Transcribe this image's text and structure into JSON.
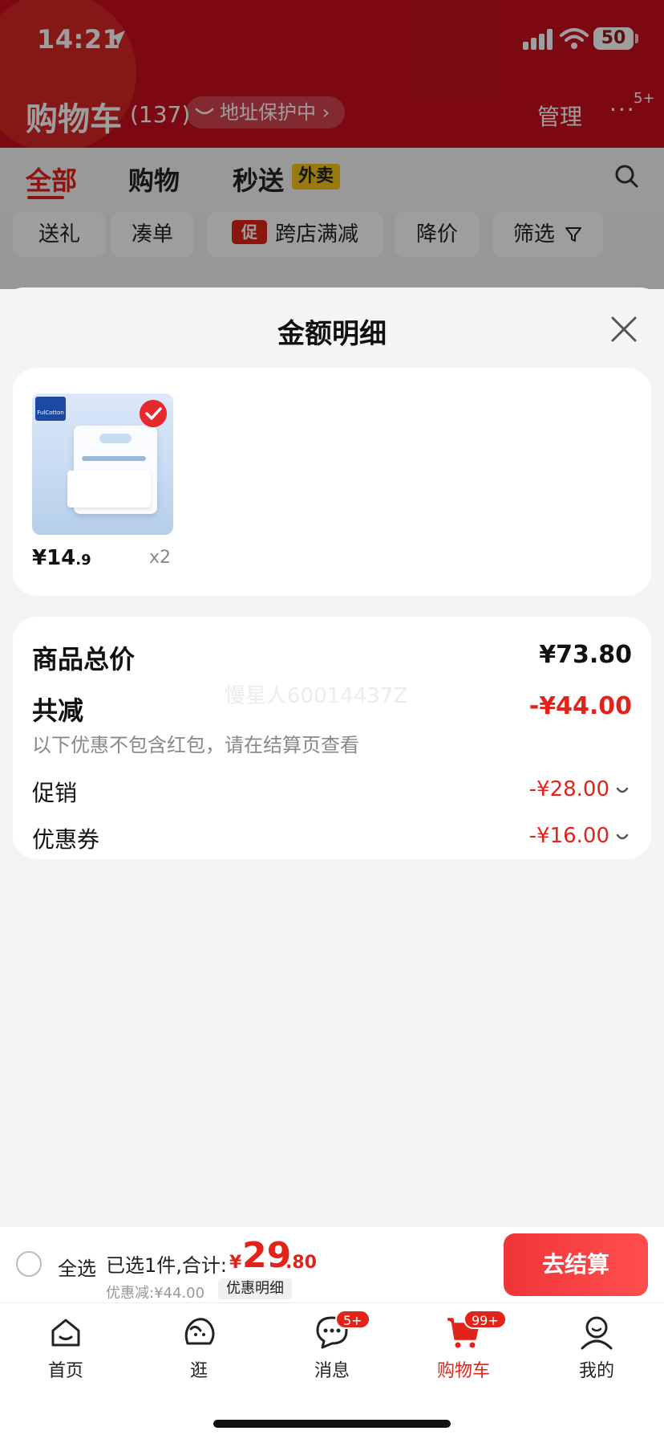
{
  "status_bar": {
    "time": "14:21",
    "battery": "50"
  },
  "header": {
    "title": "购物车",
    "count": "(137)",
    "address_pill": "地址保护中 ›",
    "manage": "管理",
    "more_badge": "5+"
  },
  "tabs": [
    {
      "label": "全部",
      "active": true
    },
    {
      "label": "购物",
      "active": false
    },
    {
      "label": "秒送",
      "active": false,
      "tag": "外卖"
    }
  ],
  "filter_chips": [
    {
      "label": "送礼"
    },
    {
      "label": "凑单"
    },
    {
      "label": "跨店满减",
      "tag": "促"
    },
    {
      "label": "降价"
    },
    {
      "label": "筛选"
    }
  ],
  "sheet": {
    "title": "金额明细",
    "item": {
      "price_int": "¥14",
      "price_dec": ".9",
      "qty": "x2",
      "brand": "FulCotton"
    },
    "summary": {
      "total_label": "商品总价",
      "total_value": "¥73.80",
      "reduce_label": "共减",
      "reduce_value": "-¥44.00",
      "note": "以下优惠不包含红包，请在结算页查看",
      "promo_label": "促销",
      "promo_value": "-¥28.00",
      "coupon_label": "优惠券",
      "coupon_value": "-¥16.00"
    },
    "watermark": "慢星人60014437Z"
  },
  "checkout": {
    "select_all": "全选",
    "selected": "已选1件,合计:",
    "yen": "¥",
    "total_int": "29",
    "total_dec": ".80",
    "discount": "优惠减:¥44.00",
    "detail": "优惠明细",
    "button": "去结算"
  },
  "nav": [
    {
      "label": "首页",
      "icon": "home-icon"
    },
    {
      "label": "逛",
      "icon": "browse-icon"
    },
    {
      "label": "消息",
      "icon": "message-icon",
      "badge": "5+"
    },
    {
      "label": "购物车",
      "icon": "cart-icon",
      "badge": "99+",
      "active": true
    },
    {
      "label": "我的",
      "icon": "profile-icon"
    }
  ],
  "colors": {
    "brand_red": "#e2231a",
    "header_red": "#c8101e",
    "waimai_yellow": "#f5c518"
  }
}
